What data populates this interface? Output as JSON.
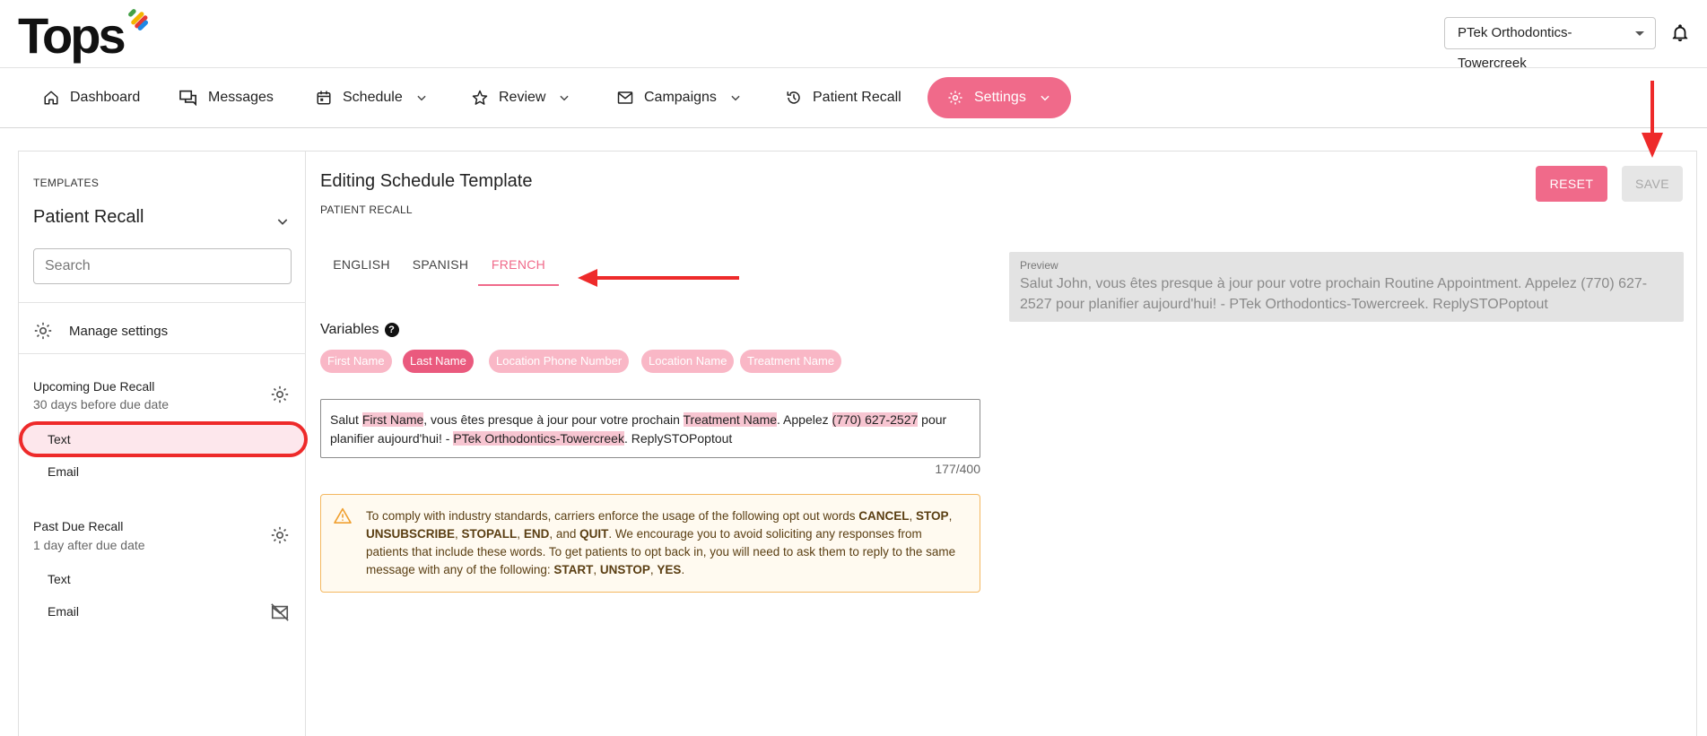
{
  "brand": {
    "logo_text": "Tops"
  },
  "header": {
    "location": "PTek Orthodontics-Towercreek"
  },
  "nav": {
    "items": [
      {
        "label": "Dashboard",
        "icon": "home-icon"
      },
      {
        "label": "Messages",
        "icon": "messages-icon"
      },
      {
        "label": "Schedule",
        "icon": "calendar-icon"
      },
      {
        "label": "Review",
        "icon": "star-icon"
      },
      {
        "label": "Campaigns",
        "icon": "mail-icon"
      },
      {
        "label": "Patient Recall",
        "icon": "history-icon"
      },
      {
        "label": "Settings",
        "icon": "gear-icon"
      }
    ]
  },
  "sidebar": {
    "templates_label": "TEMPLATES",
    "selected_template": "Patient Recall",
    "search_placeholder": "Search",
    "manage_settings": "Manage settings",
    "groups": [
      {
        "title": "Upcoming Due Recall",
        "subtitle": "30 days before due date",
        "items": [
          "Text",
          "Email"
        ]
      },
      {
        "title": "Past Due Recall",
        "subtitle": "1 day after due date",
        "items": [
          "Text",
          "Email"
        ]
      }
    ]
  },
  "content": {
    "title": "Editing Schedule Template",
    "subtitle": "PATIENT RECALL",
    "reset_label": "RESET",
    "save_label": "SAVE",
    "tabs": [
      "ENGLISH",
      "SPANISH",
      "FRENCH"
    ],
    "active_tab": "FRENCH",
    "variables_label": "Variables",
    "help": "?",
    "variables": [
      "First Name",
      "Last Name",
      "Location Phone Number",
      "Location Name",
      "Treatment Name"
    ],
    "active_variable": "Last Name",
    "message": {
      "t1": "Salut ",
      "v1": "First Name",
      "t2": ", vous êtes presque à jour pour votre prochain ",
      "v2": "Treatment Name",
      "t3": ". Appelez ",
      "v3": "(770) 627-2527",
      "t4": " pour planifier aujourd'hui! - ",
      "v4": "PTek Orthodontics-Towercreek",
      "t5": ". ReplySTOPoptout"
    },
    "counter": "177/400",
    "warning": {
      "t1": "To comply with industry standards, carriers enforce the usage of the following opt out words ",
      "b1": "CANCEL",
      "t2": ", ",
      "b2": "STOP",
      "t3": ", ",
      "b3": "UNSUBSCRIBE",
      "t4": ", ",
      "b4": "STOPALL",
      "t5": ", ",
      "b5": "END",
      "t6": ", and ",
      "b6": "QUIT",
      "t7": ". We encourage you to avoid soliciting any responses from patients that include these words. To get patients to opt back in, you will need to ask them to reply to the same message with any of the following: ",
      "b7": "START",
      "t8": ", ",
      "b8": "UNSTOP",
      "t9": ", ",
      "b9": "YES",
      "t10": "."
    },
    "preview_label": "Preview",
    "preview_text": "Salut John, vous êtes presque à jour pour votre prochain Routine Appointment. Appelez (770) 627-2527 pour planifier aujourd'hui! - PTek Orthodontics-Towercreek. ReplySTOPoptout"
  },
  "colors": {
    "accent": "#f06a8a",
    "annotation_red": "#ee2a2a",
    "chip_light": "#f9b7c6",
    "warning_border": "#f4b860"
  }
}
